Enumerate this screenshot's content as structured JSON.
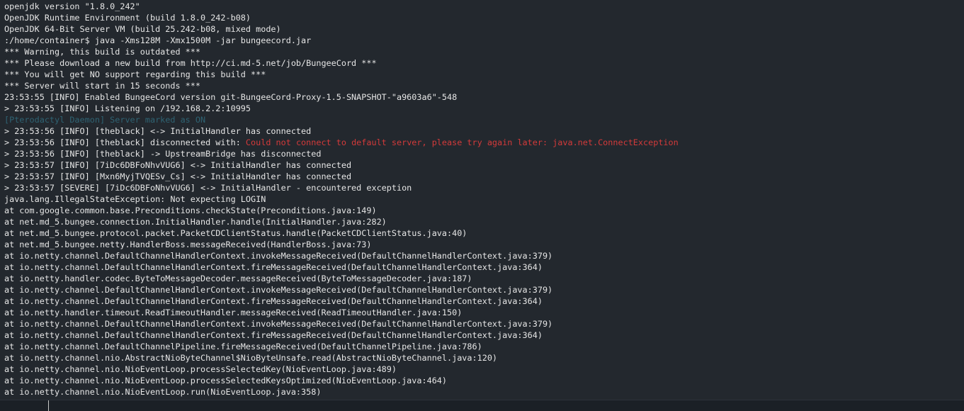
{
  "console": {
    "lines": [
      {
        "segments": [
          {
            "text": "openjdk version \"1.8.0_242\""
          }
        ]
      },
      {
        "segments": [
          {
            "text": "OpenJDK Runtime Environment (build 1.8.0_242-b08)"
          }
        ]
      },
      {
        "segments": [
          {
            "text": "OpenJDK 64-Bit Server VM (build 25.242-b08, mixed mode)"
          }
        ]
      },
      {
        "segments": [
          {
            "text": ":/home/container$ java -Xms128M -Xmx1500M -jar bungeecord.jar"
          }
        ]
      },
      {
        "segments": [
          {
            "text": "*** Warning, this build is outdated ***"
          }
        ]
      },
      {
        "segments": [
          {
            "text": "*** Please download a new build from http://ci.md-5.net/job/BungeeCord ***"
          }
        ]
      },
      {
        "segments": [
          {
            "text": "*** You will get NO support regarding this build ***"
          }
        ]
      },
      {
        "segments": [
          {
            "text": "*** Server will start in 15 seconds ***"
          }
        ]
      },
      {
        "segments": [
          {
            "text": "23:53:55 [INFO] Enabled BungeeCord version git-BungeeCord-Proxy-1.5-SNAPSHOT-\"a9603a6\"-548"
          }
        ]
      },
      {
        "segments": [
          {
            "text": "> 23:53:55 [INFO] Listening on /192.168.2.2:10995"
          }
        ]
      },
      {
        "segments": [
          {
            "text": "[Pterodactyl Daemon] Server marked as ON",
            "style": "daemon"
          }
        ]
      },
      {
        "segments": [
          {
            "text": "> 23:53:56 [INFO] [theblack] <-> InitialHandler has connected"
          }
        ]
      },
      {
        "segments": [
          {
            "text": "> 23:53:56 [INFO] [theblack] disconnected with: "
          },
          {
            "text": "Could not connect to default server, please try again later: java.net.ConnectException",
            "style": "err"
          }
        ]
      },
      {
        "segments": [
          {
            "text": "> 23:53:56 [INFO] [theblack] -> UpstreamBridge has disconnected"
          }
        ]
      },
      {
        "segments": [
          {
            "text": "> 23:53:57 [INFO] [7iDc6DBFoNhvVUG6] <-> InitialHandler has connected"
          }
        ]
      },
      {
        "segments": [
          {
            "text": "> 23:53:57 [INFO] [Mxn6MyjTVQESv_Cs] <-> InitialHandler has connected"
          }
        ]
      },
      {
        "segments": [
          {
            "text": "> 23:53:57 [SEVERE] [7iDc6DBFoNhvVUG6] <-> InitialHandler - encountered exception"
          }
        ]
      },
      {
        "segments": [
          {
            "text": "java.lang.IllegalStateException: Not expecting LOGIN"
          }
        ]
      },
      {
        "segments": [
          {
            "text": "at com.google.common.base.Preconditions.checkState(Preconditions.java:149)"
          }
        ]
      },
      {
        "segments": [
          {
            "text": "at net.md_5.bungee.connection.InitialHandler.handle(InitialHandler.java:282)"
          }
        ]
      },
      {
        "segments": [
          {
            "text": "at net.md_5.bungee.protocol.packet.PacketCDClientStatus.handle(PacketCDClientStatus.java:40)"
          }
        ]
      },
      {
        "segments": [
          {
            "text": "at net.md_5.bungee.netty.HandlerBoss.messageReceived(HandlerBoss.java:73)"
          }
        ]
      },
      {
        "segments": [
          {
            "text": "at io.netty.channel.DefaultChannelHandlerContext.invokeMessageReceived(DefaultChannelHandlerContext.java:379)"
          }
        ]
      },
      {
        "segments": [
          {
            "text": "at io.netty.channel.DefaultChannelHandlerContext.fireMessageReceived(DefaultChannelHandlerContext.java:364)"
          }
        ]
      },
      {
        "segments": [
          {
            "text": "at io.netty.handler.codec.ByteToMessageDecoder.messageReceived(ByteToMessageDecoder.java:187)"
          }
        ]
      },
      {
        "segments": [
          {
            "text": "at io.netty.channel.DefaultChannelHandlerContext.invokeMessageReceived(DefaultChannelHandlerContext.java:379)"
          }
        ]
      },
      {
        "segments": [
          {
            "text": "at io.netty.channel.DefaultChannelHandlerContext.fireMessageReceived(DefaultChannelHandlerContext.java:364)"
          }
        ]
      },
      {
        "segments": [
          {
            "text": "at io.netty.handler.timeout.ReadTimeoutHandler.messageReceived(ReadTimeoutHandler.java:150)"
          }
        ]
      },
      {
        "segments": [
          {
            "text": "at io.netty.channel.DefaultChannelHandlerContext.invokeMessageReceived(DefaultChannelHandlerContext.java:379)"
          }
        ]
      },
      {
        "segments": [
          {
            "text": "at io.netty.channel.DefaultChannelHandlerContext.fireMessageReceived(DefaultChannelHandlerContext.java:364)"
          }
        ]
      },
      {
        "segments": [
          {
            "text": "at io.netty.channel.DefaultChannelPipeline.fireMessageReceived(DefaultChannelPipeline.java:786)"
          }
        ]
      },
      {
        "segments": [
          {
            "text": "at io.netty.channel.nio.AbstractNioByteChannel$NioByteUnsafe.read(AbstractNioByteChannel.java:120)"
          }
        ]
      },
      {
        "segments": [
          {
            "text": "at io.netty.channel.nio.NioEventLoop.processSelectedKey(NioEventLoop.java:489)"
          }
        ]
      },
      {
        "segments": [
          {
            "text": "at io.netty.channel.nio.NioEventLoop.processSelectedKeysOptimized(NioEventLoop.java:464)"
          }
        ]
      },
      {
        "segments": [
          {
            "text": "at io.netty.channel.nio.NioEventLoop.run(NioEventLoop.java:358)"
          }
        ]
      }
    ]
  },
  "input": {
    "prompt_icon": "chevron-right-icon",
    "value": ""
  },
  "colors": {
    "background": "#23282e",
    "text": "#e6e6e6",
    "daemon": "#2f6373",
    "error": "#d33a3a"
  }
}
